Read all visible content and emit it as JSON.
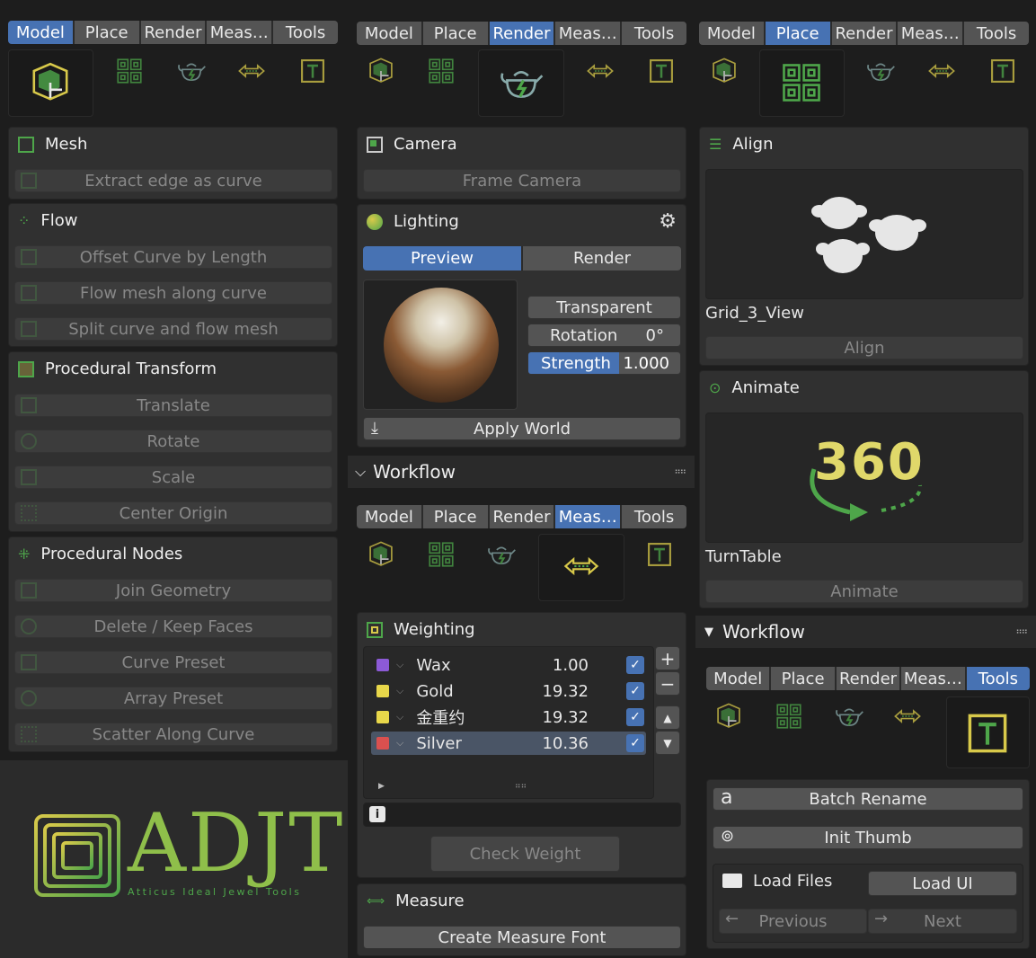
{
  "tabs": {
    "model": "Model",
    "place": "Place",
    "render": "Render",
    "meas": "Meas…",
    "tools": "Tools"
  },
  "left": {
    "mesh": {
      "title": "Mesh",
      "buttons": [
        "Extract edge as curve"
      ]
    },
    "flow": {
      "title": "Flow",
      "buttons": [
        "Offset Curve by Length",
        "Flow mesh along curve",
        "Split curve and flow mesh"
      ]
    },
    "proc_transform": {
      "title": "Procedural Transform",
      "buttons": [
        "Translate",
        "Rotate",
        "Scale",
        "Center Origin"
      ]
    },
    "proc_nodes": {
      "title": "Procedural Nodes",
      "buttons": [
        "Join Geometry",
        "Delete / Keep Faces",
        "Curve Preset",
        "Array Preset",
        "Scatter Along Curve"
      ]
    },
    "logo": {
      "text": "ADJT",
      "subtitle": "Atticus Ideal Jewel Tools"
    }
  },
  "mid": {
    "camera": {
      "title": "Camera",
      "button": "Frame Camera"
    },
    "lighting": {
      "title": "Lighting",
      "tab_preview": "Preview",
      "tab_render": "Render",
      "transparent": "Transparent",
      "rotation_label": "Rotation",
      "rotation_value": "0°",
      "strength_label": "Strength",
      "strength_value": "1.000",
      "strength_fraction": 0.6,
      "apply": "Apply World"
    },
    "workflow": {
      "title": "Workflow"
    },
    "weighting": {
      "title": "Weighting",
      "items": [
        {
          "name": "Wax",
          "value": "1.00",
          "color": "#8c5ad6",
          "checked": true
        },
        {
          "name": "Gold",
          "value": "19.32",
          "color": "#e8d74a",
          "checked": true
        },
        {
          "name": "金重约",
          "value": "19.32",
          "color": "#e8d74a",
          "checked": true
        },
        {
          "name": "Silver",
          "value": "10.36",
          "color": "#d9504f",
          "checked": true
        }
      ],
      "plus": "+",
      "minus": "−",
      "check": "Check Weight"
    },
    "measure": {
      "title": "Measure",
      "button": "Create Measure Font"
    }
  },
  "right": {
    "align": {
      "title": "Align",
      "preview_label": "Grid_3_View",
      "button": "Align"
    },
    "animate": {
      "title": "Animate",
      "preview_text": "360",
      "preview_label": "TurnTable",
      "button": "Animate"
    },
    "workflow": {
      "title": "Workflow"
    },
    "tools": {
      "batch": "Batch Rename",
      "thumb": "Init Thumb",
      "load_files": "Load Files",
      "load_ui": "Load UI",
      "previous": "Previous",
      "next": "Next"
    }
  },
  "colors": {
    "accent": "#4772b3",
    "icon_green": "#4ea64a",
    "icon_yellow": "#d8c94a"
  }
}
